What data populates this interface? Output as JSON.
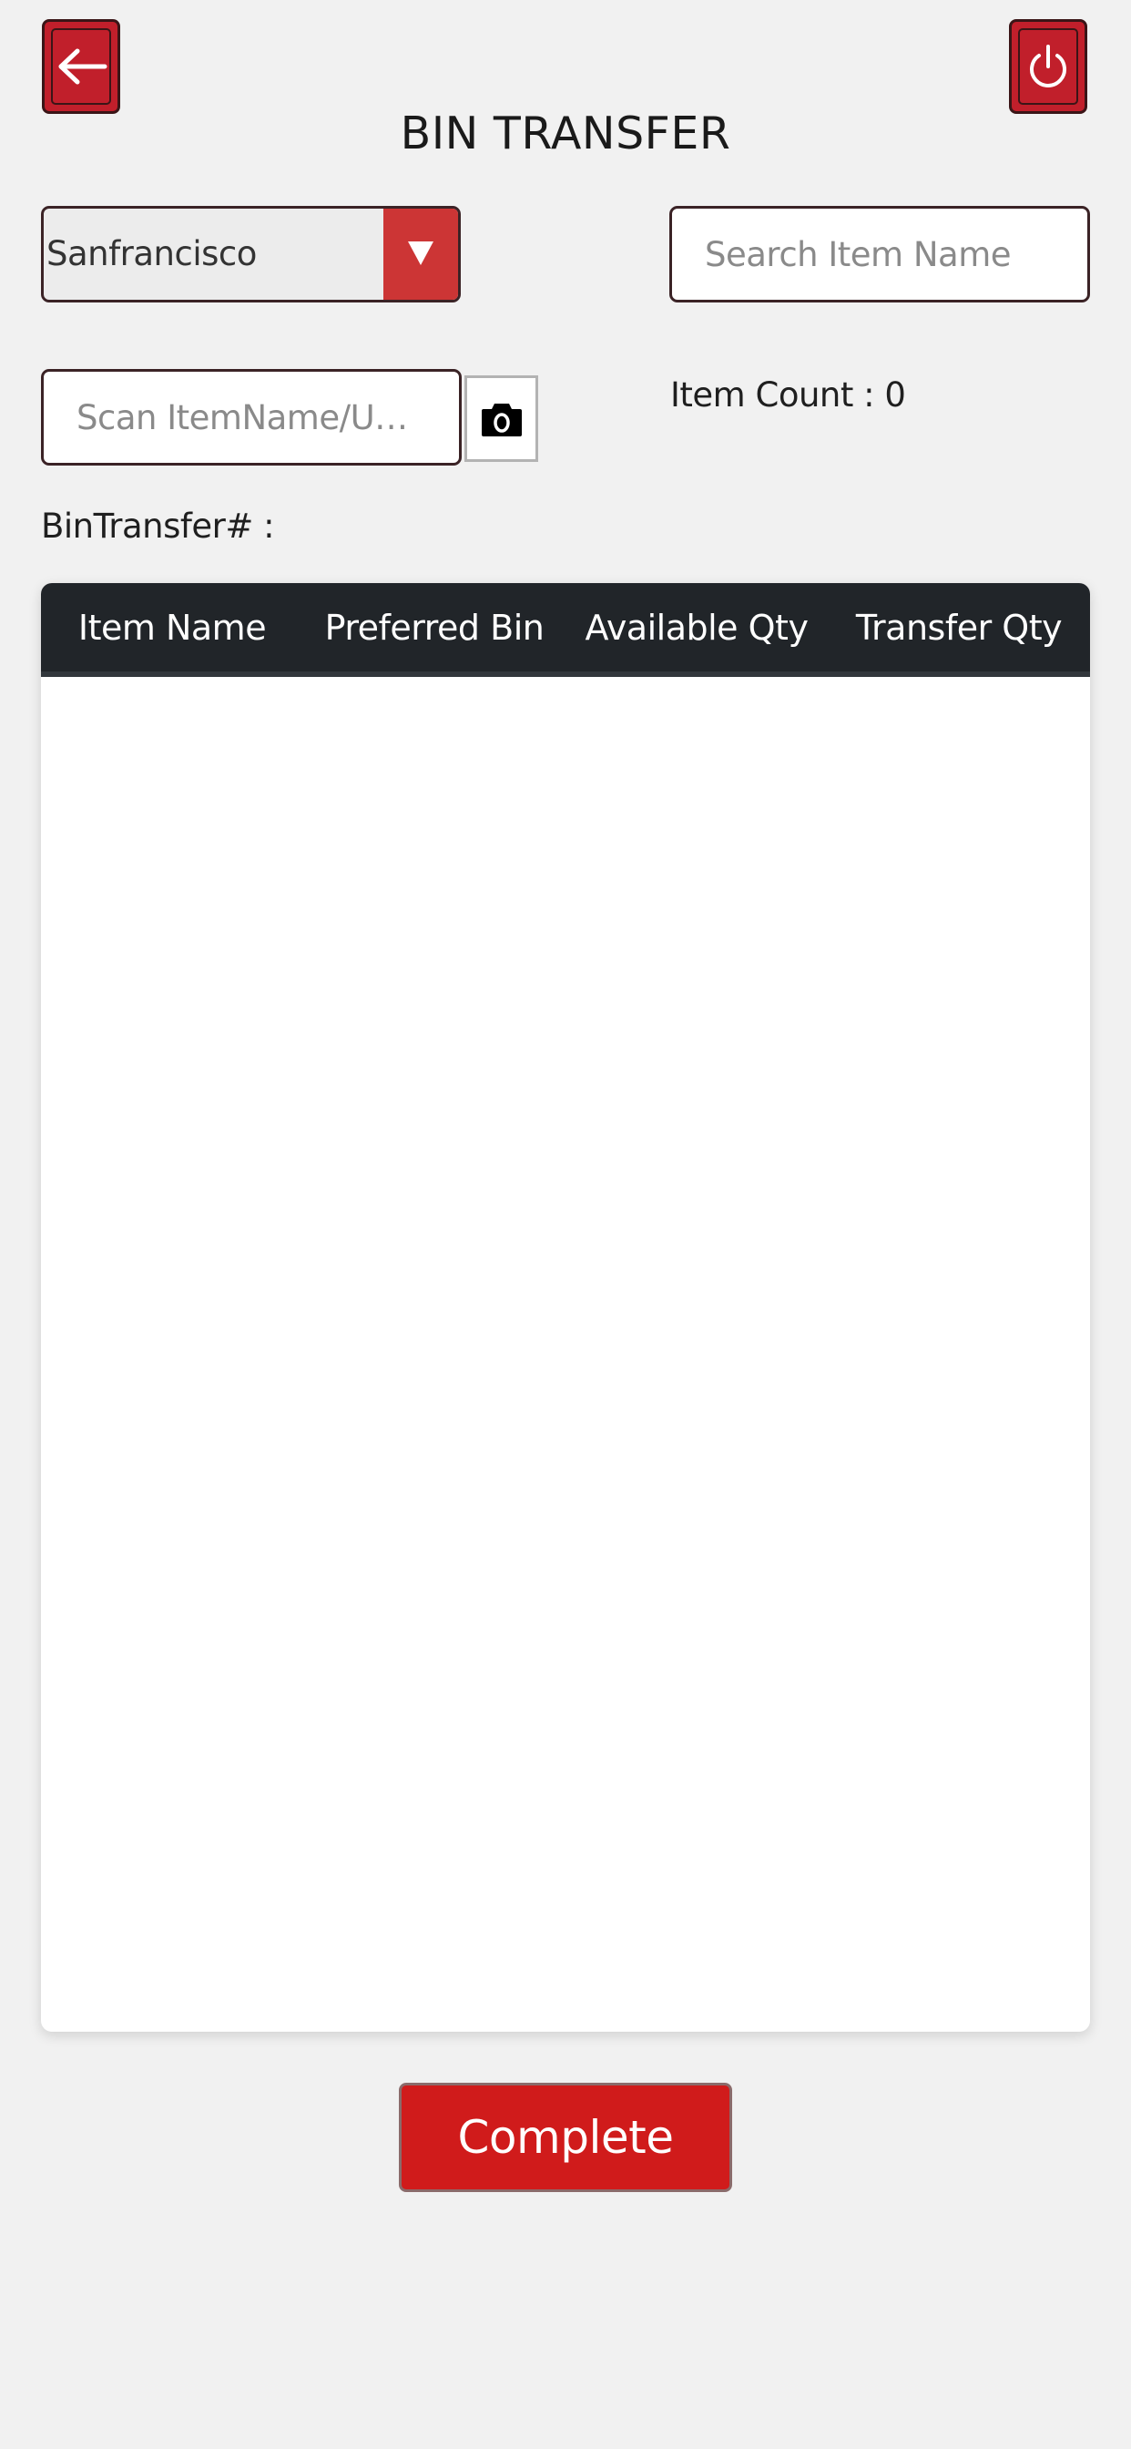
{
  "header": {
    "title": "BIN TRANSFER",
    "back_icon": "arrow-left-icon",
    "power_icon": "power-icon"
  },
  "filters": {
    "location": {
      "selected": "Sanfrancisco",
      "dropdown_icon": "triangle-down-icon"
    },
    "search": {
      "placeholder": "Search Item Name",
      "value": ""
    },
    "scan": {
      "placeholder": "Scan ItemName/UPC/Serial",
      "value": "",
      "camera_icon": "camera-icon"
    },
    "item_count": "Item Count : 0",
    "bin_transfer_number": "BinTransfer# :"
  },
  "table": {
    "columns": [
      "Item Name",
      "Preferred Bin",
      "Available Qty",
      "Transfer Qty"
    ],
    "rows": []
  },
  "actions": {
    "complete_label": "Complete"
  },
  "colors": {
    "accent": "#c11f2b",
    "button": "#d01b1b",
    "header_bg": "#212529",
    "page_bg": "#f1f1f1"
  }
}
